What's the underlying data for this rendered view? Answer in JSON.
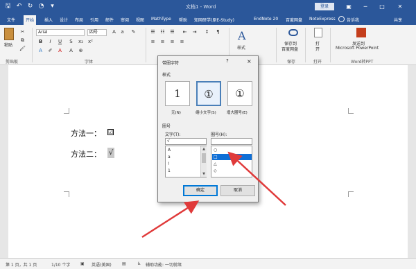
{
  "titlebar": {
    "doc_title": "文档1 - Word",
    "login": "登录",
    "quick_access": [
      "save-icon",
      "undo-icon",
      "redo-icon",
      "autosave-icon",
      "customize-icon"
    ]
  },
  "tabs": [
    {
      "label": "文件",
      "active": false
    },
    {
      "label": "开始",
      "active": true
    },
    {
      "label": "插入",
      "active": false
    },
    {
      "label": "设计",
      "active": false
    },
    {
      "label": "布局",
      "active": false
    },
    {
      "label": "引用",
      "active": false
    },
    {
      "label": "邮件",
      "active": false
    },
    {
      "label": "审阅",
      "active": false
    },
    {
      "label": "视图",
      "active": false
    },
    {
      "label": "MathType",
      "active": false
    },
    {
      "label": "帮助",
      "active": false
    },
    {
      "label": "知网研学(原E-Study)",
      "active": false
    },
    {
      "label": "EndNote 20",
      "active": false
    },
    {
      "label": "百度网盘",
      "active": false
    },
    {
      "label": "NoteExpress",
      "active": false
    }
  ],
  "tell_me": "告诉我",
  "share": "共享",
  "ribbon": {
    "paste": "粘贴",
    "clipboard": "剪贴板",
    "font_name": "Arial",
    "font_size": "四号",
    "font_group": "字体",
    "styles": "样式",
    "save_to_baidu_line1": "保存到",
    "save_to_baidu_line2": "百度网盘",
    "save_group": "保存",
    "open_line1": "打",
    "open_line2": "开",
    "open_group": "打开",
    "send_to_line1": "发送到",
    "send_to_line2": "Microsoft PowerPoint",
    "word_ppt_group": "Word转PPT"
  },
  "document": {
    "line1": "方法一：",
    "line2": "方法二：",
    "checkbox_glyph": "☑",
    "sqrt_glyph": "√"
  },
  "dialog": {
    "title": "带圈字符",
    "help": "?",
    "close": "×",
    "style_label": "样式",
    "styles": [
      {
        "glyph": "1",
        "caption": "无(N)",
        "selected": false
      },
      {
        "glyph": "①",
        "caption": "缩小文字(S)",
        "selected": true
      },
      {
        "glyph": "①",
        "caption": "增大圈号(E)",
        "selected": false
      }
    ],
    "circle_label": "圈号",
    "text_label": "文字(T):",
    "circle_field_label": "圈号(H):",
    "text_value": "√",
    "text_items": [
      "A",
      "a",
      "!",
      "1"
    ],
    "circle_items": [
      "○",
      "□",
      "△",
      "◇"
    ],
    "circle_selected_index": 1,
    "ok": "确定",
    "cancel": "取消"
  },
  "status": {
    "page": "第 1 页，共 1 页",
    "words": "1/10 个字",
    "lang": "英语(美国)",
    "accessibility": "辅助功能: 一切就绪"
  },
  "colors": {
    "brand": "#2b579a",
    "selection": "#0f6fd6",
    "arrow": "#e03a3a"
  }
}
